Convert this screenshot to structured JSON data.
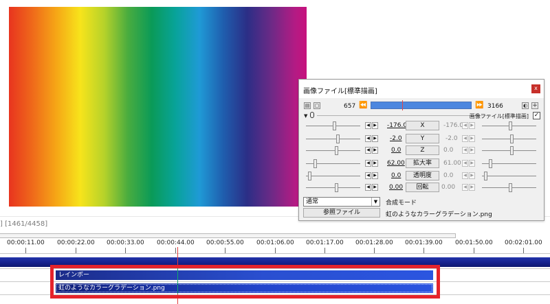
{
  "preview": {
    "gradient_colors": [
      "#e8341f",
      "#f6a716",
      "#f7e41b",
      "#49ac3f",
      "#0a9a58",
      "#1f9ad6",
      "#2b2e86",
      "#c7117d"
    ]
  },
  "frame_readout": "] [1461/4458]",
  "timeline": {
    "ticks": [
      "00:00:11.00",
      "00:00:22.00",
      "00:00:33.00",
      "00:00:44.00",
      "00:00:55.00",
      "00:01:06.00",
      "00:01:17.00",
      "00:01:28.00",
      "00:01:39.00",
      "00:01:50.00",
      "00:02:01.00"
    ],
    "clips": [
      {
        "label": "レインボー"
      },
      {
        "label": "虹のようなカラーグラデーション.png"
      }
    ]
  },
  "dialog": {
    "title": "画像ファイル[標準描画]",
    "close_label": "x",
    "frame_start": "657",
    "frame_end": "3166",
    "frame_prev_label": "⏪",
    "frame_next_label": "⏩",
    "add_label": "+",
    "group_label": "画像ファイル[標準描画]",
    "checkbox_mark": "✓",
    "params": [
      {
        "name": "X",
        "value": "-176.0",
        "end_value": "-176.0"
      },
      {
        "name": "Y",
        "value": "-2.0",
        "end_value": "-2.0"
      },
      {
        "name": "Z",
        "value": "0.0",
        "end_value": "0.0"
      },
      {
        "name": "拡大率",
        "value": "62.00",
        "end_value": "61.00"
      },
      {
        "name": "透明度",
        "value": "0.0",
        "end_value": "0.0"
      },
      {
        "name": "回転",
        "value": "0.00",
        "end_value": "0.00"
      }
    ],
    "blend_select": "通常",
    "blend_label": "合成モード",
    "ref_button": "参照ファイル",
    "file_name": "虹のようなカラーグラデーション.png"
  }
}
